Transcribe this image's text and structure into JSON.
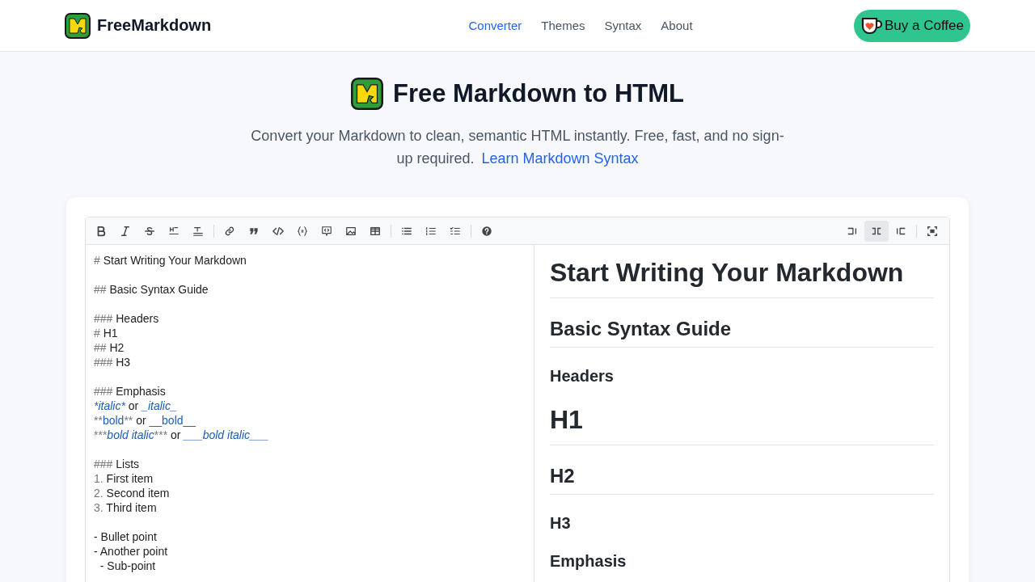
{
  "header": {
    "brand": "FreeMarkdown",
    "nav": [
      {
        "label": "Converter",
        "selected": true
      },
      {
        "label": "Themes",
        "selected": false
      },
      {
        "label": "Syntax",
        "selected": false
      },
      {
        "label": "About",
        "selected": false
      }
    ],
    "coffee_button": "Buy a Coffee"
  },
  "hero": {
    "title": "Free Markdown to HTML",
    "subtitle": "Convert your Markdown to clean, semantic HTML instantly. Free, fast, and no sign-up required.",
    "link": "Learn Markdown Syntax"
  },
  "editor": {
    "view_modes": [
      {
        "selected": false
      },
      {
        "selected": true
      },
      {
        "selected": false
      }
    ],
    "lines": [
      {
        "kind": "text",
        "segments": [
          {
            "kind": "mark",
            "text": "#"
          },
          {
            "kind": "plain",
            "text": " Start Writing Your Markdown"
          }
        ]
      },
      {
        "kind": "blank"
      },
      {
        "kind": "text",
        "segments": [
          {
            "kind": "mark",
            "text": "##"
          },
          {
            "kind": "plain",
            "text": " Basic Syntax Guide"
          }
        ]
      },
      {
        "kind": "blank"
      },
      {
        "kind": "text",
        "segments": [
          {
            "kind": "mark",
            "text": "###"
          },
          {
            "kind": "plain",
            "text": " Headers"
          }
        ]
      },
      {
        "kind": "text",
        "segments": [
          {
            "kind": "mark",
            "text": "#"
          },
          {
            "kind": "plain",
            "text": " H1"
          }
        ]
      },
      {
        "kind": "text",
        "segments": [
          {
            "kind": "mark",
            "text": "##"
          },
          {
            "kind": "plain",
            "text": " H2"
          }
        ]
      },
      {
        "kind": "text",
        "segments": [
          {
            "kind": "mark",
            "text": "###"
          },
          {
            "kind": "plain",
            "text": " H3"
          }
        ]
      },
      {
        "kind": "blank"
      },
      {
        "kind": "text",
        "segments": [
          {
            "kind": "mark",
            "text": "###"
          },
          {
            "kind": "plain",
            "text": " Emphasis"
          }
        ]
      },
      {
        "kind": "text",
        "segments": [
          {
            "kind": "em-mark",
            "text": "*"
          },
          {
            "kind": "em",
            "text": "italic"
          },
          {
            "kind": "em-mark",
            "text": "*"
          },
          {
            "kind": "plain",
            "text": " or "
          },
          {
            "kind": "em",
            "text": "_italic_"
          }
        ]
      },
      {
        "kind": "text",
        "segments": [
          {
            "kind": "mark",
            "text": "**"
          },
          {
            "kind": "strong",
            "text": "bold"
          },
          {
            "kind": "mark",
            "text": "**"
          },
          {
            "kind": "plain",
            "text": " or "
          },
          {
            "kind": "strong",
            "text": "__bold__"
          }
        ]
      },
      {
        "kind": "text",
        "segments": [
          {
            "kind": "mark",
            "text": "***"
          },
          {
            "kind": "em",
            "text": "bold italic"
          },
          {
            "kind": "mark",
            "text": "***"
          },
          {
            "kind": "plain",
            "text": " or "
          },
          {
            "kind": "em",
            "text": "___bold italic___"
          }
        ]
      },
      {
        "kind": "blank"
      },
      {
        "kind": "text",
        "segments": [
          {
            "kind": "mark",
            "text": "###"
          },
          {
            "kind": "plain",
            "text": " Lists"
          }
        ]
      },
      {
        "kind": "text",
        "segments": [
          {
            "kind": "mark",
            "text": "1."
          },
          {
            "kind": "plain",
            "text": " First item"
          }
        ]
      },
      {
        "kind": "text",
        "segments": [
          {
            "kind": "mark",
            "text": "2."
          },
          {
            "kind": "plain",
            "text": " Second item"
          }
        ]
      },
      {
        "kind": "text",
        "segments": [
          {
            "kind": "mark",
            "text": "3."
          },
          {
            "kind": "plain",
            "text": " Third item"
          }
        ]
      },
      {
        "kind": "blank"
      },
      {
        "kind": "text",
        "segments": [
          {
            "kind": "plain",
            "text": "- Bullet point"
          }
        ]
      },
      {
        "kind": "text",
        "segments": [
          {
            "kind": "plain",
            "text": "- Another point"
          }
        ]
      },
      {
        "kind": "text",
        "segments": [
          {
            "kind": "plain",
            "text": "  - Sub-point"
          }
        ]
      }
    ]
  },
  "preview": [
    {
      "kind": "h1",
      "text": "Start Writing Your Markdown"
    },
    {
      "kind": "h2",
      "text": "Basic Syntax Guide"
    },
    {
      "kind": "h3",
      "text": "Headers"
    },
    {
      "kind": "h1",
      "text": "H1"
    },
    {
      "kind": "h2",
      "text": "H2"
    },
    {
      "kind": "h3",
      "text": "H3"
    },
    {
      "kind": "h3",
      "text": "Emphasis"
    }
  ]
}
